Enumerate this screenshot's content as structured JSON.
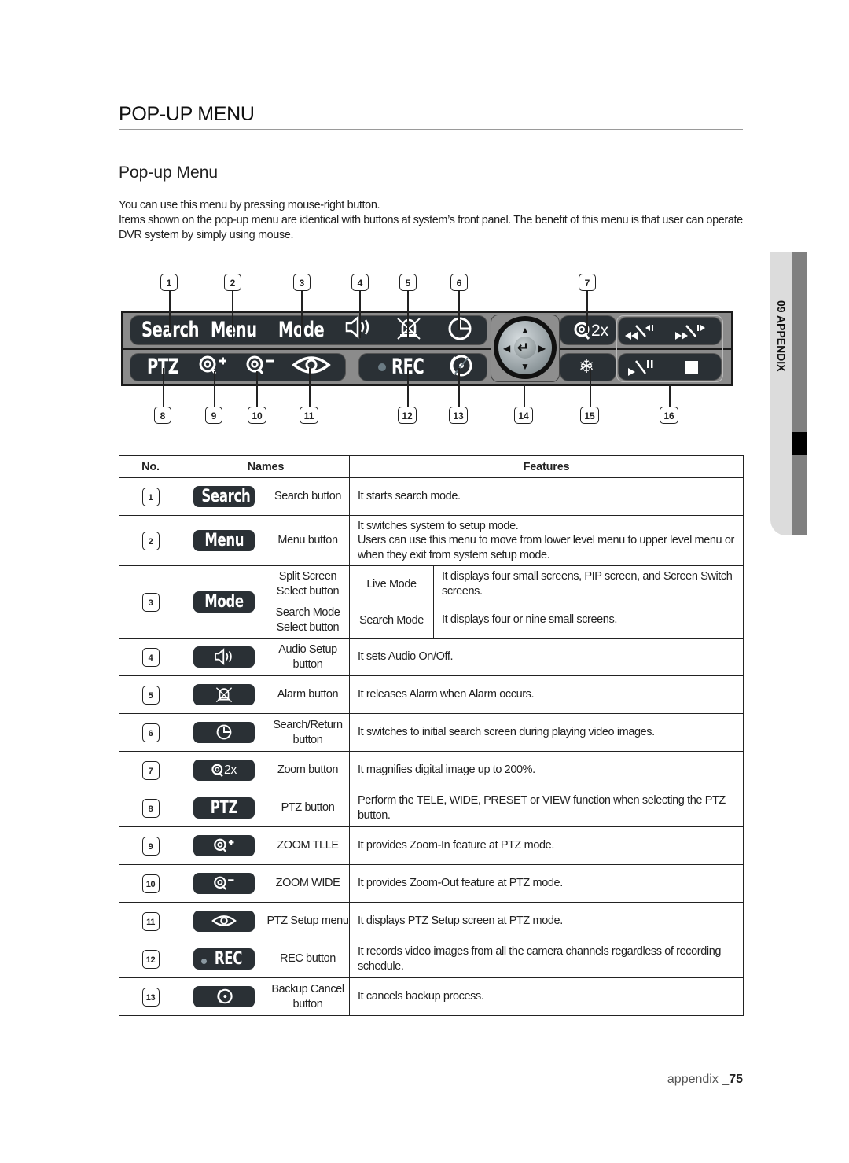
{
  "header": {
    "section_title": "POP-UP MENU",
    "sub_title": "Pop-up Menu",
    "intro_lines": [
      "You can use this menu by pressing mouse-right button.",
      "Items shown on the pop-up menu are identical with buttons at system’s front panel. The benefit of this menu is that user can operate DVR system by simply using mouse."
    ]
  },
  "side_tab": {
    "label": "09 APPENDIX"
  },
  "diagram": {
    "top_callouts": [
      "1",
      "2",
      "3",
      "4",
      "5",
      "6",
      "7"
    ],
    "bottom_callouts": [
      "8",
      "9",
      "10",
      "11",
      "12",
      "13",
      "14",
      "15",
      "16"
    ],
    "top_bar": {
      "search": "Search",
      "menu": "Menu",
      "mode": "Mode",
      "audio_icon": "speaker-icon",
      "alarm_icon": "alarm-off-icon",
      "return_icon": "clock-return-icon"
    },
    "bottom_bar": {
      "ptz": "PTZ",
      "zoom_in_icon": "zoom-in-icon",
      "zoom_out_icon": "zoom-out-icon",
      "ptz_setup_icon": "eye-icon"
    },
    "rec_bar": {
      "rec": "REC",
      "backup_cancel_icon": "backup-cancel-icon"
    },
    "zoom_label": "2x",
    "joystick": {
      "icon": "direction-pad-icon",
      "center_icon": "enter-icon"
    },
    "freeze_icon": "snowflake-icon",
    "playback_icons": [
      "rewind-icon",
      "fast-forward-icon",
      "play-pause-icon",
      "stop-icon"
    ]
  },
  "table": {
    "headers": {
      "no": "No.",
      "names": "Names",
      "features": "Features"
    },
    "rows": [
      {
        "no": "1",
        "button": "Search",
        "name": "Search button",
        "feature": "It starts search mode."
      },
      {
        "no": "2",
        "button": "Menu",
        "name": "Menu button",
        "feature": "It switches system to setup mode.\nUsers can use this menu to move from lower level menu to upper level menu or when they exit from system setup mode."
      },
      {
        "no": "3",
        "button": "Mode",
        "subrows": [
          {
            "name": "Split Screen Select button",
            "mode": "Live Mode",
            "feature": "It displays four small screens, PIP screen, and Screen Switch screens."
          },
          {
            "name": "Search Mode Select button",
            "mode": "Search Mode",
            "feature": "It displays four or nine small screens."
          }
        ]
      },
      {
        "no": "4",
        "button_icon": "speaker-icon",
        "name": "Audio Setup button",
        "feature": "It sets Audio On/Off."
      },
      {
        "no": "5",
        "button_icon": "alarm-off-icon",
        "name": "Alarm button",
        "feature": "It releases Alarm when Alarm occurs."
      },
      {
        "no": "6",
        "button_icon": "clock-return-icon",
        "name": "Search/Return button",
        "feature": "It switches to initial search screen during playing video images."
      },
      {
        "no": "7",
        "button": "2x",
        "button_icon": "zoom-2x-icon",
        "name": "Zoom button",
        "feature": "It magnifies digital image up to 200%."
      },
      {
        "no": "8",
        "button": "PTZ",
        "name": "PTZ button",
        "feature": "Perform the TELE, WIDE, PRESET or VIEW function when selecting the PTZ button."
      },
      {
        "no": "9",
        "button_icon": "zoom-in-icon",
        "name": "ZOOM TLLE",
        "feature": "It provides Zoom-In feature at PTZ mode."
      },
      {
        "no": "10",
        "button_icon": "zoom-out-icon",
        "name": "ZOOM WIDE",
        "feature": "It provides Zoom-Out feature at PTZ mode."
      },
      {
        "no": "11",
        "button_icon": "eye-icon",
        "name": "PTZ Setup menu",
        "feature": "It displays PTZ Setup screen at PTZ mode."
      },
      {
        "no": "12",
        "button": "REC",
        "name": "REC button",
        "feature": "It records video images from all the camera channels regardless of recording schedule."
      },
      {
        "no": "13",
        "button_icon": "backup-cancel-icon",
        "name": "Backup Cancel button",
        "feature": "It cancels backup process."
      }
    ]
  },
  "footer": {
    "section": "appendix _",
    "page": "75"
  }
}
